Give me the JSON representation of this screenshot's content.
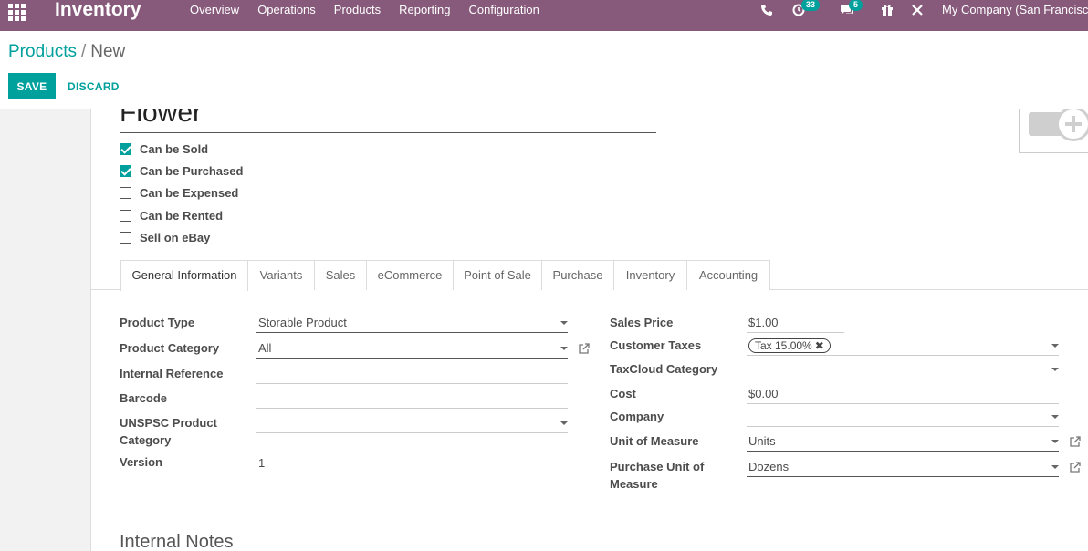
{
  "navbar": {
    "brand": "Inventory",
    "menu": [
      "Overview",
      "Operations",
      "Products",
      "Reporting",
      "Configuration"
    ],
    "activity_count": "33",
    "messages_count": "5",
    "company": "My Company (San Francisco"
  },
  "breadcrumb": {
    "parent": "Products",
    "separator": "/",
    "current": "New"
  },
  "buttons": {
    "save": "SAVE",
    "discard": "DISCARD"
  },
  "product": {
    "name": "Flower",
    "checkboxes": [
      {
        "label": "Can be Sold",
        "checked": true
      },
      {
        "label": "Can be Purchased",
        "checked": true
      },
      {
        "label": "Can be Expensed",
        "checked": false
      },
      {
        "label": "Can be Rented",
        "checked": false
      },
      {
        "label": "Sell on eBay",
        "checked": false
      }
    ]
  },
  "tabs": [
    "General Information",
    "Variants",
    "Sales",
    "eCommerce",
    "Point of Sale",
    "Purchase",
    "Inventory",
    "Accounting"
  ],
  "left_fields": {
    "product_type": {
      "label": "Product Type",
      "value": "Storable Product"
    },
    "product_category": {
      "label": "Product Category",
      "value": "All"
    },
    "internal_reference": {
      "label": "Internal Reference",
      "value": ""
    },
    "barcode": {
      "label": "Barcode",
      "value": ""
    },
    "unspsc": {
      "label_line1": "UNSPSC Product",
      "label_line2": "Category",
      "value": ""
    },
    "version": {
      "label": "Version",
      "value": "1"
    }
  },
  "right_fields": {
    "sales_price": {
      "label": "Sales Price",
      "value": "$1.00"
    },
    "customer_taxes": {
      "label": "Customer Taxes",
      "tag": "Tax 15.00%"
    },
    "taxcloud_category": {
      "label": "TaxCloud Category",
      "value": ""
    },
    "cost": {
      "label": "Cost",
      "value": "$0.00"
    },
    "company": {
      "label": "Company",
      "value": ""
    },
    "uom": {
      "label": "Unit of Measure",
      "value": "Units"
    },
    "purchase_uom": {
      "label_line1": "Purchase Unit of",
      "label_line2": "Measure",
      "value": "Dozens"
    }
  },
  "internal_notes_title": "Internal Notes",
  "colors": {
    "brand": "#875a7b",
    "accent": "#00a09d"
  }
}
